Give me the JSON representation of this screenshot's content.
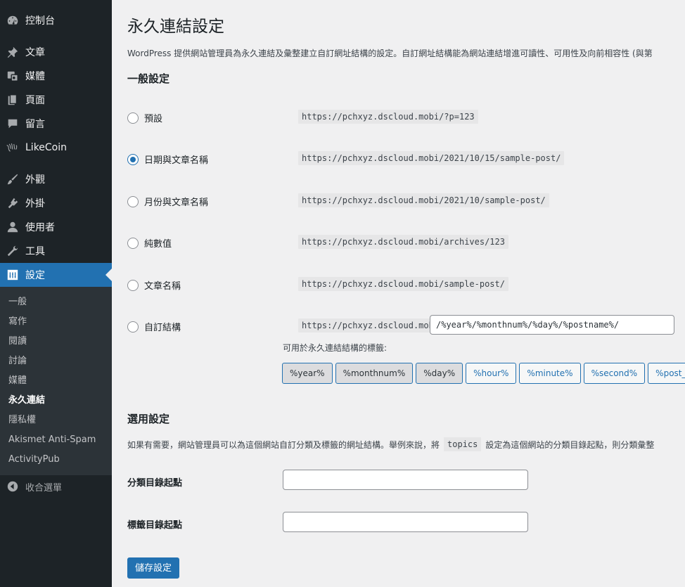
{
  "sidebar": {
    "dashboard": "控制台",
    "posts": "文章",
    "media": "媒體",
    "pages": "頁面",
    "comments": "留言",
    "likecoin": "LikeCoin",
    "appearance": "外觀",
    "plugins": "外掛",
    "users": "使用者",
    "tools": "工具",
    "settings": "設定",
    "submenu": [
      "一般",
      "寫作",
      "閱讀",
      "討論",
      "媒體",
      "永久連結",
      "隱私權",
      "Akismet Anti-Spam",
      "ActivityPub"
    ],
    "collapse": "收合選單"
  },
  "page": {
    "title": "永久連結設定",
    "intro": "WordPress 提供網站管理員為永久連結及彙整建立自訂網址結構的設定。自訂網址結構能為網站連結增進可讀性、可用性及向前相容性 (與第"
  },
  "common": {
    "heading": "一般設定",
    "options": [
      {
        "label": "預設",
        "example": "https://pchxyz.dscloud.mobi/?p=123",
        "checked": false
      },
      {
        "label": "日期與文章名稱",
        "example": "https://pchxyz.dscloud.mobi/2021/10/15/sample-post/",
        "checked": true
      },
      {
        "label": "月份與文章名稱",
        "example": "https://pchxyz.dscloud.mobi/2021/10/sample-post/",
        "checked": false
      },
      {
        "label": "純數值",
        "example": "https://pchxyz.dscloud.mobi/archives/123",
        "checked": false
      },
      {
        "label": "文章名稱",
        "example": "https://pchxyz.dscloud.mobi/sample-post/",
        "checked": false
      },
      {
        "label": "自訂結構",
        "example": "https://pchxyz.dscloud.mobi",
        "checked": false
      }
    ],
    "custom_value": "/%year%/%monthnum%/%day%/%postname%/",
    "tags_label": "可用於永久連結結構的標籤:",
    "tags": [
      "%year%",
      "%monthnum%",
      "%day%",
      "%hour%",
      "%minute%",
      "%second%",
      "%post_id%"
    ]
  },
  "optional": {
    "heading": "選用設定",
    "desc_before": "如果有需要，網站管理員可以為這個網站自訂分類及標籤的網址結構。舉例來說，將",
    "desc_code": "topics",
    "desc_after": "設定為這個網站的分類目錄起點，則分類彙整",
    "category_base_label": "分類目錄起點",
    "tag_base_label": "標籤目錄起點",
    "category_base_value": "",
    "tag_base_value": ""
  },
  "save_label": "儲存設定",
  "colors": {
    "accent": "#2271b1",
    "sidebar": "#1d2327",
    "submenu": "#2c3338",
    "background": "#f0f0f1"
  }
}
